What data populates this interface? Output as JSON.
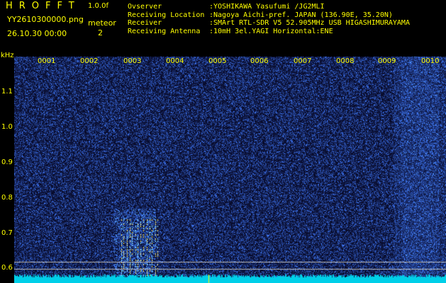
{
  "header": {
    "app_title": "HROFFT",
    "version": "1.0.0f",
    "file_name": "YY2610300000.png",
    "datetime": "26.10.30 00:00",
    "meteor_label": "meteor",
    "meteor_count": "2"
  },
  "info": [
    {
      "key": "Ovserver",
      "value": ":YOSHIKAWA Yasufumi /JG2MLI"
    },
    {
      "key": "Receiving Location",
      "value": ":Nagoya Aichi-pref. JAPAN (136.90E, 35.20N)"
    },
    {
      "key": "Receiver",
      "value": ":SMArt RTL-SDR V5 52.905MHz USB HIGASHIMURAYAMA"
    },
    {
      "key": "Receiving Antenna",
      "value": ":10mH 3el.YAGI Horizontal:ENE"
    }
  ],
  "axis": {
    "unit_label": "kHz",
    "y_ticks": [
      "1.1",
      "1.0",
      "0.9",
      "0.8",
      "0.7",
      "0.6"
    ],
    "time_ticks": [
      "0001",
      "0002",
      "0003",
      "0004",
      "0005",
      "0006",
      "0007",
      "0008",
      "0009",
      "0010"
    ]
  },
  "colors": {
    "background": "#000000",
    "text": "#ffff00",
    "noise_dark": "#0a0a3c",
    "noise_bright": "#3a4cff",
    "baseline": "#00e5ff",
    "ref_line": "#c8c8c8"
  }
}
